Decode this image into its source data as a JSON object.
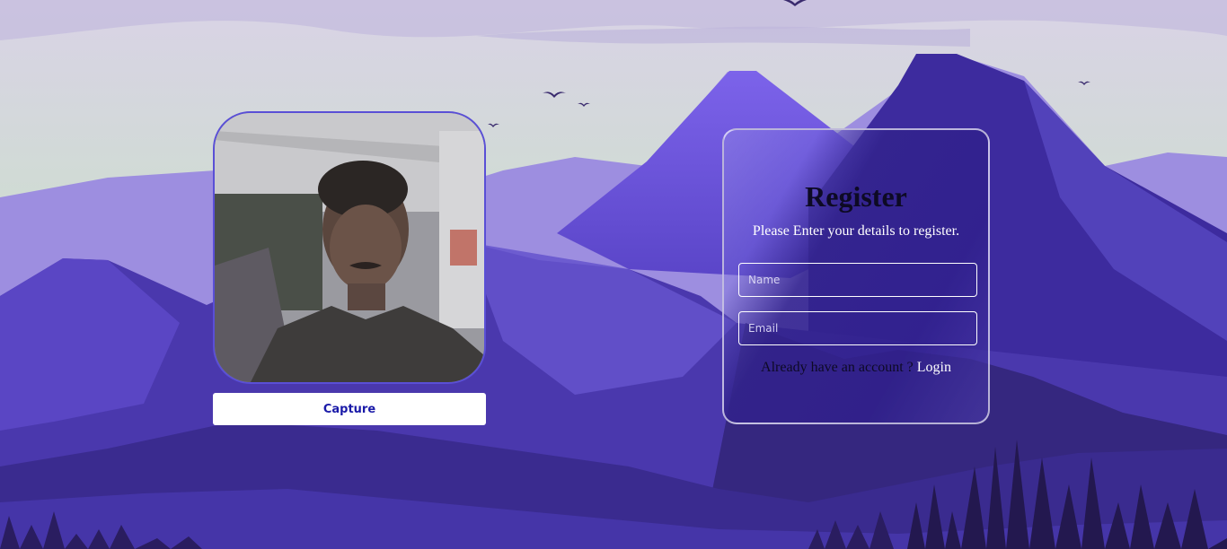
{
  "webcam": {
    "subject": "webcam-feed"
  },
  "capture": {
    "label": "Capture"
  },
  "register": {
    "title": "Register",
    "subtitle": "Please Enter your details to register.",
    "name_placeholder": "Name",
    "email_placeholder": "Email",
    "login_prompt": "Already have an account ?",
    "login_link": "Login"
  },
  "colors": {
    "sky_top": "#d8d4e6",
    "sky_green": "#cfe3c8",
    "mountain_dark": "#2e2170",
    "mountain_mid": "#4b3bb0",
    "mountain_light": "#7a6ae6",
    "capture_text": "#1a1aa8"
  }
}
